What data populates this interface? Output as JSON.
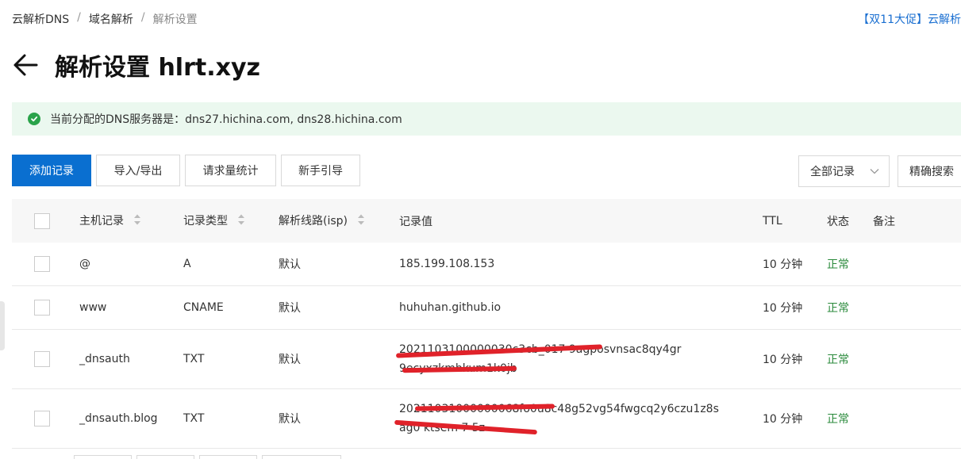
{
  "breadcrumb": [
    "云解析DNS",
    "域名解析",
    "解析设置"
  ],
  "breadcrumb_sep": "/",
  "promo": "【双11大促】云解析",
  "title": "解析设置 hlrt.xyz",
  "notice": "当前分配的DNS服务器是：dns27.hichina.com, dns28.hichina.com",
  "toolbar": {
    "add": "添加记录",
    "import_export": "导入/导出",
    "stats": "请求量统计",
    "guide": "新手引导",
    "filter_select": "全部记录",
    "precise_search": "精确搜索"
  },
  "columns": {
    "host": "主机记录",
    "type": "记录类型",
    "line": "解析线路(isp)",
    "value": "记录值",
    "ttl": "TTL",
    "status": "状态",
    "note": "备注"
  },
  "rows": [
    {
      "host": "@",
      "type": "A",
      "line": "默认",
      "value": "185.199.108.153",
      "value2": "",
      "ttl": "10 分钟",
      "status": "正常"
    },
    {
      "host": "www",
      "type": "CNAME",
      "line": "默认",
      "value": "huhuhan.github.io",
      "value2": "",
      "ttl": "10 分钟",
      "status": "正常"
    },
    {
      "host": "_dnsauth",
      "type": "TXT",
      "line": "默认",
      "value": "2021103100000030c3cb_017 9agposvnsac8qy4gr",
      "value2": "9ecyxzkmhkum1k0jb",
      "ttl": "10 分钟",
      "status": "正常"
    },
    {
      "host": "_dnsauth.blog",
      "type": "TXT",
      "line": "默认",
      "value": "20211031000000068fo0u8c48g52vg54fwgcq2y6czu1z8s",
      "value2": "ag0 ktsem 7 5z",
      "ttl": "10 分钟",
      "status": "正常"
    }
  ],
  "colors": {
    "primary": "#0a6fd0",
    "success": "#2aa34a",
    "notice_bg": "#ebf8ef",
    "redaction": "#e0222a"
  }
}
